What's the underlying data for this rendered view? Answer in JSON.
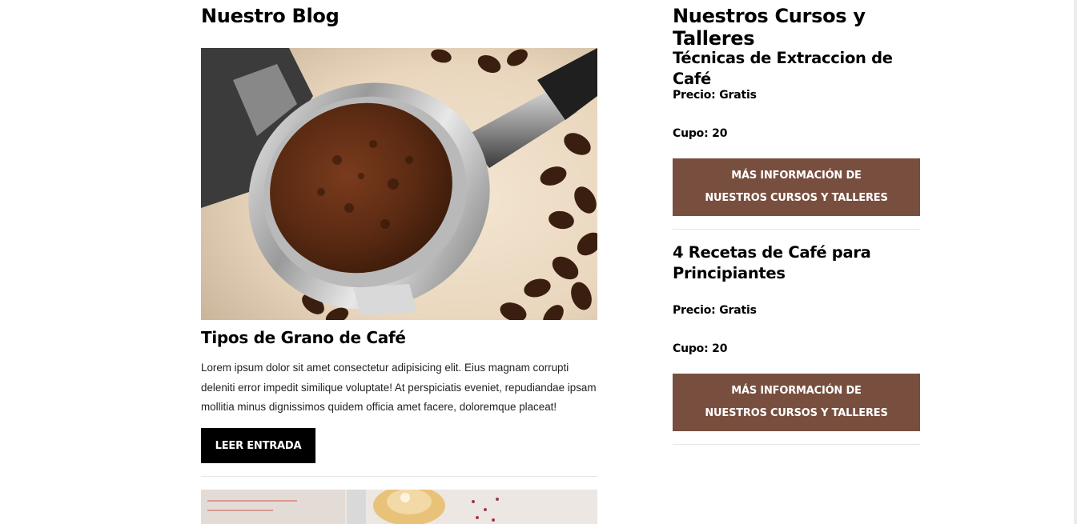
{
  "blog": {
    "heading": "Nuestro Blog",
    "posts": [
      {
        "image": "coffee-portafilter-photo",
        "title": "Tipos de Grano de Café",
        "excerpt": "Lorem ipsum dolor sit amet consectetur adipisicing elit. Eius magnam corrupti deleniti error impedit similique voluptate! At perspiciatis eveniet, repudiandae ipsam mollitia minus dignissimos quidem officia amet facere, doloremque placeat!",
        "button_label": "LEER ENTRADA"
      },
      {
        "image": "cupcake-photo"
      }
    ]
  },
  "courses": {
    "heading": "Nuestros Cursos y Talleres",
    "items": [
      {
        "title": "Técnicas de Extraccion de Café",
        "price": "Precio: Gratis",
        "capacity": "Cupo: 20",
        "button_label": "MÁS INFORMACIÓN DE NUESTROS CURSOS Y TALLERES"
      },
      {
        "title": "4 Recetas de Café para Principiantes",
        "price": "Precio: Gratis",
        "capacity": "Cupo: 20",
        "button_label": "MÁS INFORMACIÓN DE NUESTROS CURSOS Y TALLERES"
      }
    ]
  },
  "colors": {
    "accent_button": "#784f3f",
    "read_button": "#000000",
    "separator": "#e6e6e6"
  }
}
